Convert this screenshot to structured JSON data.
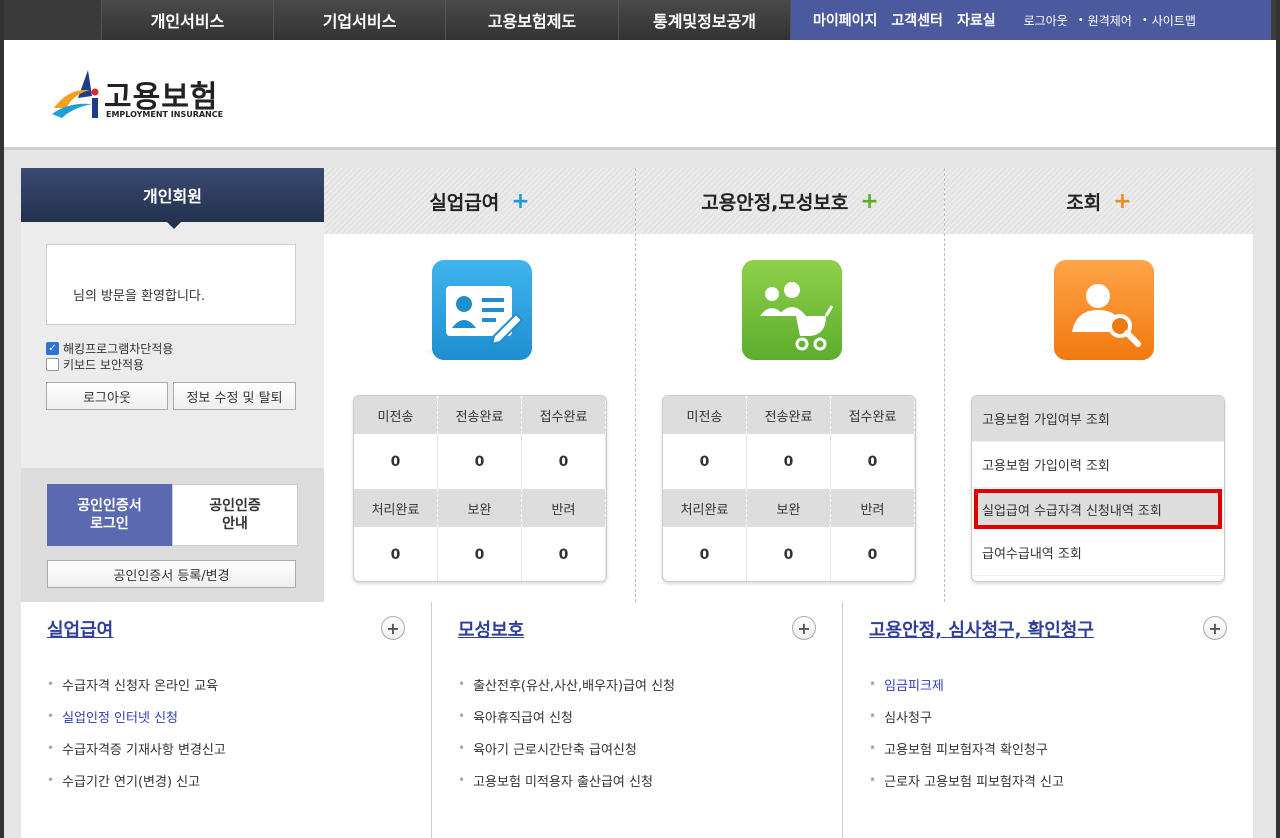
{
  "topnav": {
    "menus": [
      "개인서비스",
      "기업서비스",
      "고용보험제도",
      "통계및정보공개"
    ],
    "util_main": [
      "마이페이지",
      "고객센터",
      "자료실"
    ],
    "util_small": [
      "로그아웃",
      "원격제어",
      "사이트맵"
    ]
  },
  "logo": {
    "korean": "고용보험",
    "english": "EMPLOYMENT INSURANCE"
  },
  "left": {
    "title": "개인회원",
    "welcome": "님의 방문을 환영합니다.",
    "check1": "해킹프로그램차단적용",
    "check2": "키보드 보안적용",
    "logout": "로그아웃",
    "edit": "정보 수정 및 탈퇴",
    "cert_login_1": "공인인증서",
    "cert_login_2": "로그인",
    "cert_guide_1": "공인인증",
    "cert_guide_2": "안내",
    "cert_register": "공인인증서 등록/변경"
  },
  "cols": [
    {
      "title": "실업급여",
      "plus": "+"
    },
    {
      "title": "고용안정,모성보호",
      "plus": "+"
    },
    {
      "title": "조회",
      "plus": "+"
    }
  ],
  "stat_labels_top": [
    "미전송",
    "전송완료",
    "접수완료"
  ],
  "stat_labels_bottom": [
    "처리완료",
    "보완",
    "반려"
  ],
  "stats1": {
    "top": [
      "0",
      "0",
      "0"
    ],
    "bottom": [
      "0",
      "0",
      "0"
    ]
  },
  "stats2": {
    "top": [
      "0",
      "0",
      "0"
    ],
    "bottom": [
      "0",
      "0",
      "0"
    ]
  },
  "query": [
    "고용보험 가입여부 조회",
    "고용보험 가입이력 조회",
    "실업급여 수급자격 신청내역 조회",
    "급여수급내역 조회"
  ],
  "bottom": [
    {
      "title": "실업급여",
      "items": [
        "수급자격 신청자 온라인 교육",
        "실업인정 인터넷 신청",
        "수급자격증 기재사항 변경신고",
        "수급기간 연기(변경) 신고"
      ]
    },
    {
      "title": "모성보호",
      "items": [
        "출산전후(유산,사산,배우자)급여 신청",
        "육아휴직급여 신청",
        "육아기 근로시간단축 급여신청",
        "고용보험 미적용자 출산급여 신청"
      ]
    },
    {
      "title": "고용안정, 심사청구, 확인청구",
      "items": [
        "임금피크제",
        "심사청구",
        "고용보험 피보험자격 확인청구",
        "근로자 고용보험 피보험자격 신고"
      ]
    }
  ],
  "colors": {
    "nav": "#3d3d3d",
    "util": "#4b5a9e",
    "accent_blue": "#1e9ad6",
    "accent_green": "#5cad2e",
    "accent_orange": "#f08a1a",
    "highlight": "#e00000"
  }
}
